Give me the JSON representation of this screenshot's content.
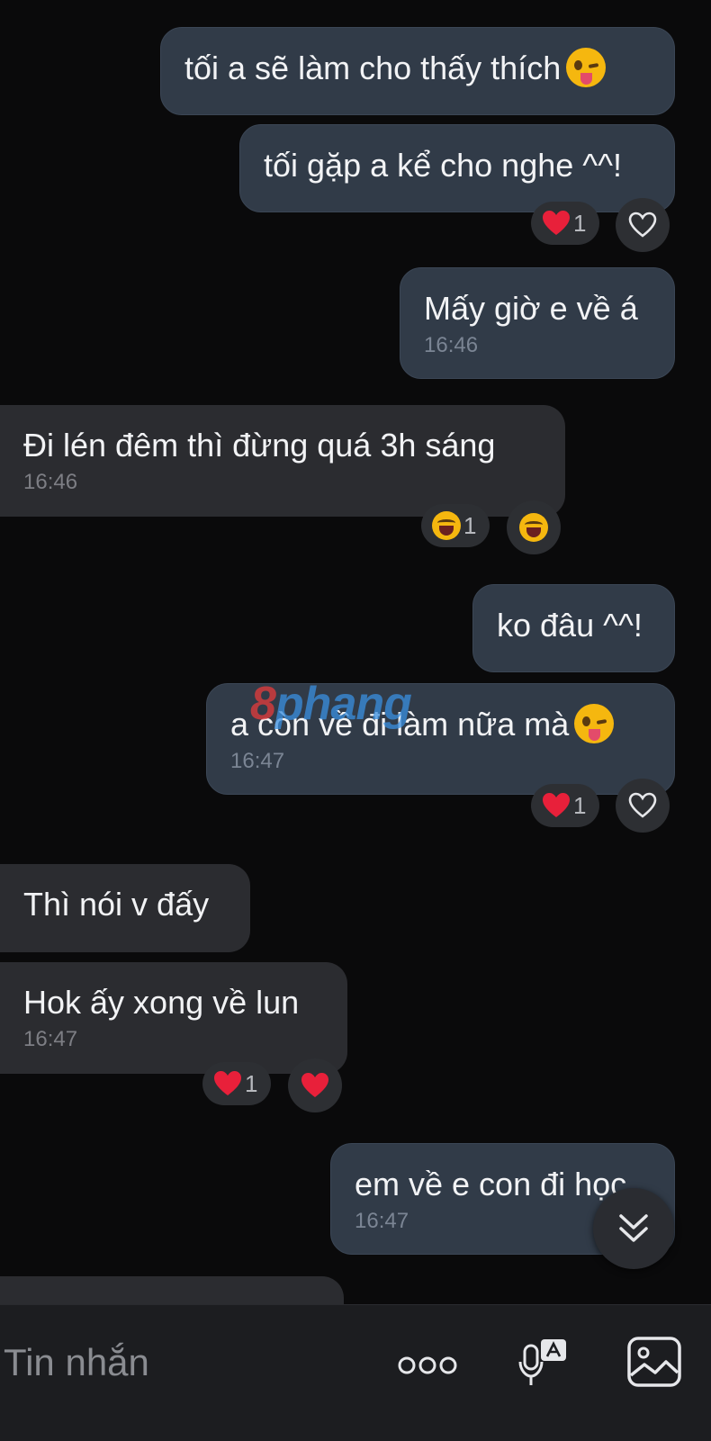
{
  "messages": [
    {
      "id": "m1",
      "text": "tối a sẽ làm cho thấy thích",
      "time": "",
      "emoji": "wink"
    },
    {
      "id": "m2",
      "text": "tối gặp a kể cho nghe ^^!",
      "time": ""
    },
    {
      "id": "m3",
      "text": "Mấy giờ e về á",
      "time": "16:46"
    },
    {
      "id": "m4",
      "text": "Đi lén đêm thì đừng quá 3h sáng",
      "time": "16:46"
    },
    {
      "id": "m5",
      "text": "ko đâu ^^!",
      "time": ""
    },
    {
      "id": "m6",
      "text": "a còn về đi làm nữa mà",
      "time": "16:47",
      "emoji": "wink"
    },
    {
      "id": "m7",
      "text": "Thì nói v đấy",
      "time": ""
    },
    {
      "id": "m8",
      "text": "Hok ấy xong về lun",
      "time": "16:47"
    },
    {
      "id": "m9",
      "text": "em về e con đi học",
      "time": "16:47"
    }
  ],
  "reactions": {
    "r_m2": {
      "emoji": "heart-icon",
      "count": "1"
    },
    "r_m4": {
      "emoji": "laughing-face-icon",
      "count": "1"
    },
    "r_m6": {
      "emoji": "heart-icon",
      "count": "1"
    },
    "r_m8": {
      "emoji": "heart-icon",
      "count": "1"
    }
  },
  "watermark": {
    "part1": "8",
    "part2": "phang"
  },
  "composer": {
    "placeholder": "Tin nhắn"
  },
  "colors": {
    "background": "#0a0a0b",
    "outgoing_bubble": "#313b48",
    "incoming_bubble": "#2b2c30",
    "composer_bar": "#1c1d20"
  }
}
